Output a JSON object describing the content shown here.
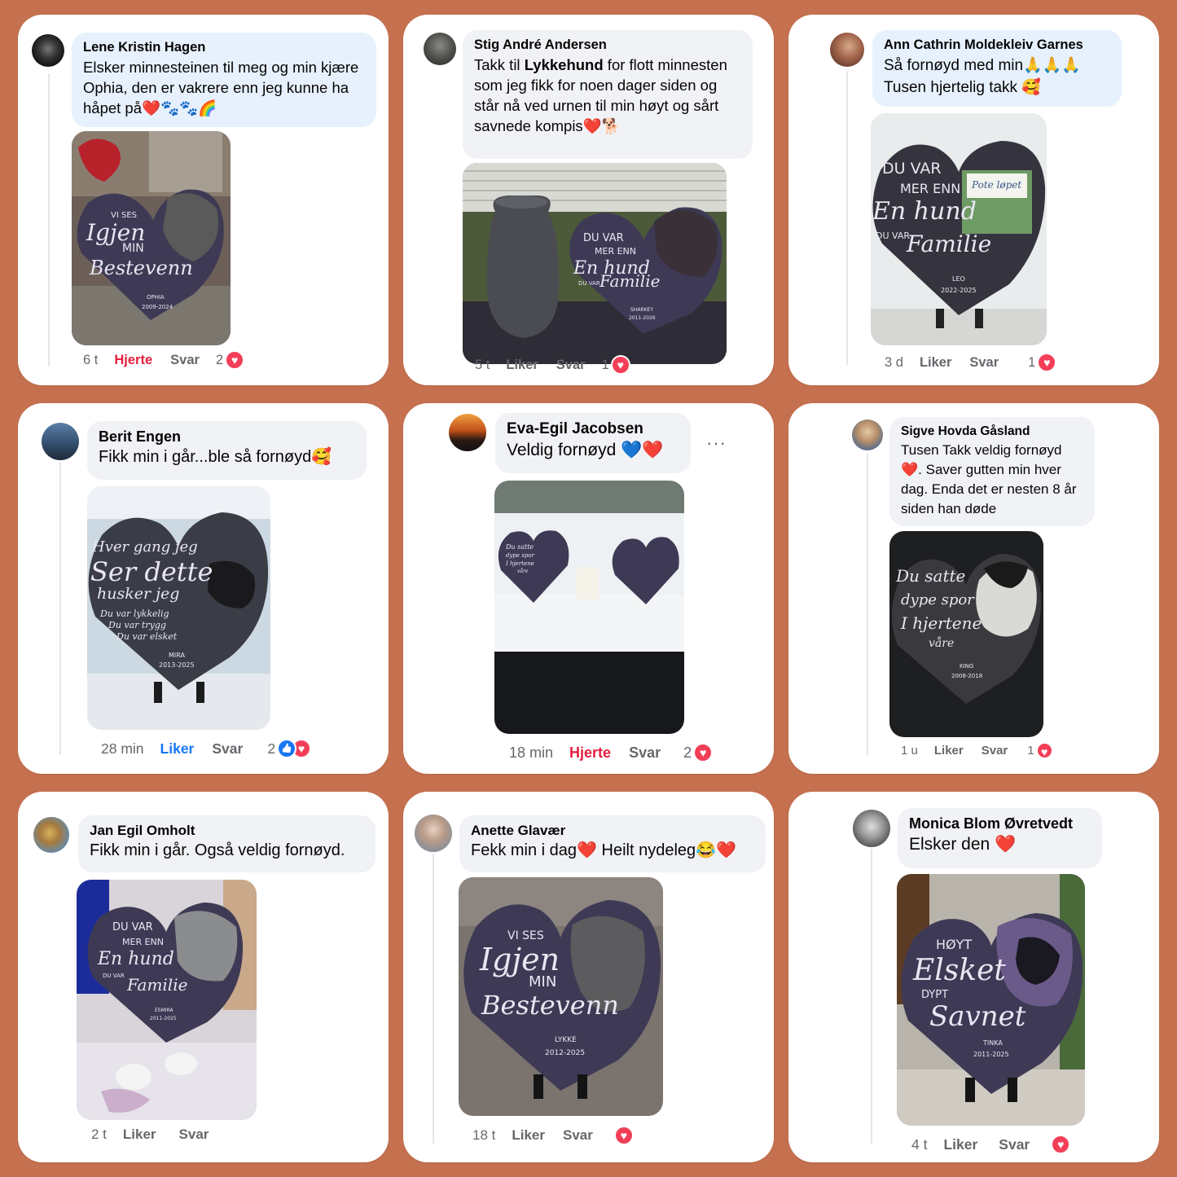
{
  "colors": {
    "background": "#c5704e",
    "heart_red": "#f33e58",
    "link_red": "#e41e3f",
    "link_blue": "#1877f2",
    "slate": "#3e3a55"
  },
  "comments": [
    {
      "name": "Lene Kristin Hagen",
      "text": "Elsker minnesteinen til meg og min kjære Ophia, den er vakrere enn jeg kunne ha håpet på❤️🐾🐾🌈",
      "time": "6 t",
      "like_label": "Hjerte",
      "reply_label": "Svar",
      "reaction_count": "2",
      "reactions": [
        "heart-icon"
      ],
      "plaque": {
        "line1": "VI SES",
        "line2": "Igjen",
        "line3": "MIN",
        "line4": "Bestevenn",
        "pet": "OPHIA",
        "years": "2009-2024"
      }
    },
    {
      "name": "Stig André Andersen",
      "text_parts": [
        "Takk til ",
        "Lykkehund",
        " for flott minnesten som jeg fikk for noen dager siden og står nå ved urnen til min høyt og sårt savnede kompis❤️🐕"
      ],
      "time": "5 t",
      "like_label": "Liker",
      "reply_label": "Svar",
      "reaction_count": "1",
      "reactions": [
        "heart-icon"
      ],
      "plaque": {
        "line1": "DU VAR",
        "line2": "MER ENN",
        "line3": "En hund",
        "line4": "DU VAR",
        "line5": "Familie",
        "pet": "SHARKEY",
        "years": "2011-2026"
      }
    },
    {
      "name": "Ann Cathrin Moldekleiv Garnes",
      "text": "Så fornøyd med min🙏🙏🙏\nTusen hjertelig takk 🥰",
      "time": "3 d",
      "like_label": "Liker",
      "reply_label": "Svar",
      "reaction_count": "1",
      "reactions": [
        "heart-icon"
      ],
      "plaque": {
        "line1": "DU VAR",
        "line2": "MER ENN",
        "line3": "En hund",
        "line4": "DU VAR",
        "line5": "Familie",
        "pet": "LEO",
        "years": "2022-2025",
        "sign": "Pote løpet"
      }
    },
    {
      "name": "Berit Engen",
      "text": "Fikk min i går...ble så fornøyd🥰",
      "time": "28 min",
      "like_label": "Liker",
      "reply_label": "Svar",
      "reaction_count": "2",
      "reactions": [
        "like-icon",
        "heart-icon"
      ],
      "plaque": {
        "line1": "Hver gang jeg",
        "line2": "Ser dette",
        "line3": "husker jeg",
        "line4": "Du var lykkelig",
        "line5": "Du var trygg",
        "line6": "Du var elsket",
        "pet": "MIRA",
        "years": "2013-2025"
      }
    },
    {
      "name": "Eva-Egil Jacobsen",
      "text": "Veldig fornøyd 💙❤️",
      "time": "18 min",
      "like_label": "Hjerte",
      "reply_label": "Svar",
      "reaction_count": "2",
      "reactions": [
        "heart-icon"
      ],
      "more": "···",
      "plaque": {
        "line1": "Du satte",
        "line2": "dype spor",
        "line3": "I hjertene",
        "line4": "våre"
      }
    },
    {
      "name": "Sigve Hovda Gåsland",
      "text": "Tusen Takk veldig fornøyd ❤️. Saver gutten min hver dag. Enda det er nesten 8 år siden han døde",
      "time": "1 u",
      "like_label": "Liker",
      "reply_label": "Svar",
      "reaction_count": "1",
      "reactions": [
        "heart-icon"
      ],
      "plaque": {
        "line1": "Du satte",
        "line2": "dype spor",
        "line3": "I hjertene",
        "line4": "våre",
        "pet": "KING",
        "years": "2008-2018"
      }
    },
    {
      "name": "Jan Egil Omholt",
      "text": "Fikk min i går. Også veldig fornøyd.",
      "time": "2 t",
      "like_label": "Liker",
      "reply_label": "Svar",
      "plaque": {
        "line1": "DU VAR",
        "line2": "MER ENN",
        "line3": "En hund",
        "line4": "DU VAR",
        "line5": "Familie",
        "pet": "ESMIRA",
        "years": "2011-2025"
      }
    },
    {
      "name": "Anette Glavær",
      "text": "Fekk min i dag❤️ Heilt nydeleg😂❤️",
      "time": "18 t",
      "like_label": "Liker",
      "reply_label": "Svar",
      "reactions": [
        "heart-icon"
      ],
      "plaque": {
        "line1": "VI SES",
        "line2": "Igjen",
        "line3": "MIN",
        "line4": "Bestevenn",
        "pet": "LYKKE",
        "years": "2012-2025"
      }
    },
    {
      "name": "Monica Blom Øvretvedt",
      "text": "Elsker den ❤️",
      "time": "4 t",
      "like_label": "Liker",
      "reply_label": "Svar",
      "reactions": [
        "heart-icon"
      ],
      "plaque": {
        "line1": "HØYT",
        "line2": "Elsket",
        "line3": "DYPT",
        "line4": "Savnet",
        "pet": "TINKA",
        "years": "2011-2025"
      }
    }
  ]
}
